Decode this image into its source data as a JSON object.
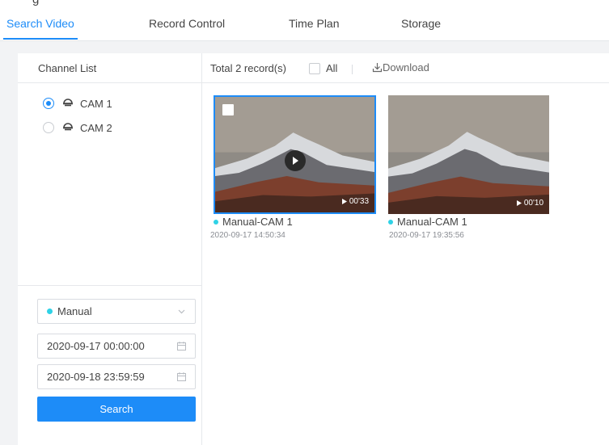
{
  "page": {
    "title_fragment": "g"
  },
  "tabs": [
    {
      "label": "Search Video",
      "active": true
    },
    {
      "label": "Record Control",
      "active": false
    },
    {
      "label": "Time Plan",
      "active": false
    },
    {
      "label": "Storage",
      "active": false
    }
  ],
  "channel_list": {
    "title": "Channel List",
    "channels": [
      {
        "label": "CAM 1",
        "selected": true,
        "icon": "dome-camera-icon"
      },
      {
        "label": "CAM 2",
        "selected": false,
        "icon": "dome-camera-icon"
      }
    ]
  },
  "filters": {
    "record_type": {
      "value": "Manual",
      "dot_color": "#2fd2e6"
    },
    "start_time": "2020-09-17 00:00:00",
    "end_time": "2020-09-18 23:59:59",
    "search_label": "Search"
  },
  "results": {
    "total_text": "Total 2 record(s)",
    "all_label": "All",
    "download_label": "Download",
    "records": [
      {
        "duration": "00'33",
        "title": "Manual-CAM 1",
        "timestamp": "2020-09-17 14:50:34",
        "selected": true
      },
      {
        "duration": "00'10",
        "title": "Manual-CAM 1",
        "timestamp": "2020-09-17 19:35:56",
        "selected": false
      }
    ]
  },
  "colors": {
    "accent": "#1d8cf8",
    "record_dot": "#2fd2e6",
    "background": "#f2f3f5"
  }
}
